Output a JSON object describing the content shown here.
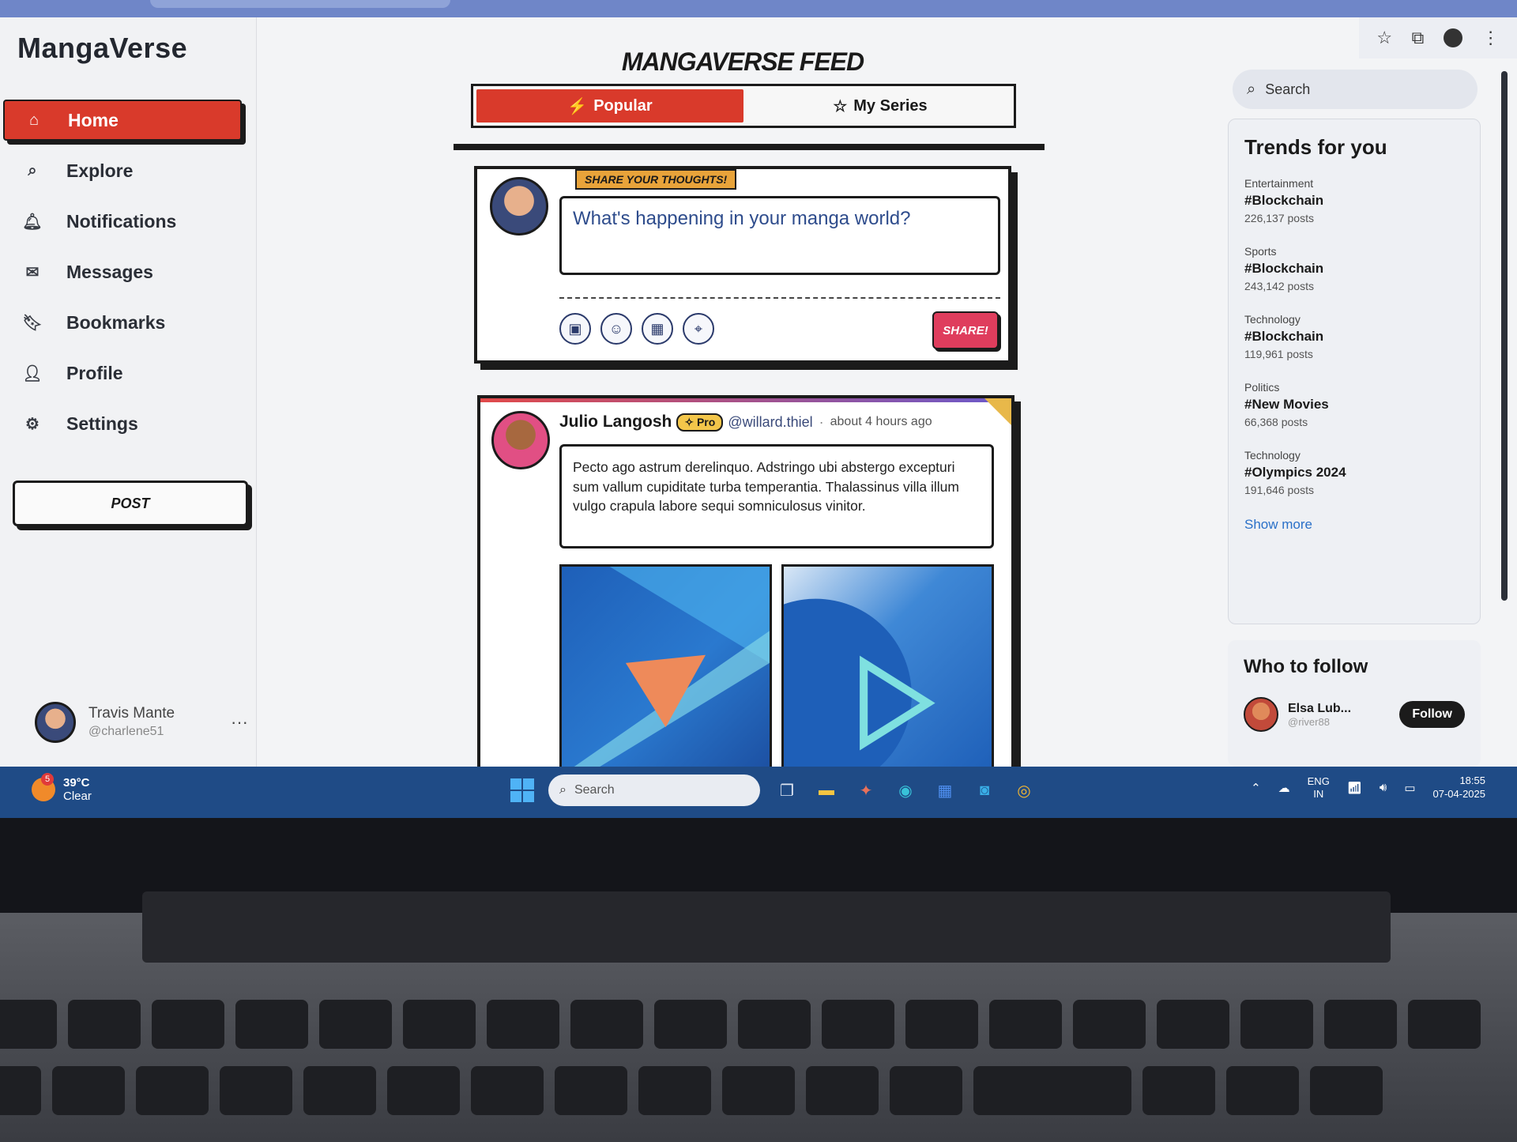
{
  "app": {
    "name": "MangaVerse"
  },
  "sidebar": {
    "items": [
      {
        "label": "Home",
        "icon": "home-icon",
        "glyph": "⌂"
      },
      {
        "label": "Explore",
        "icon": "search-icon",
        "glyph": "⌕"
      },
      {
        "label": "Notifications",
        "icon": "bell-icon",
        "glyph": "🔔︎"
      },
      {
        "label": "Messages",
        "icon": "mail-icon",
        "glyph": "✉"
      },
      {
        "label": "Bookmarks",
        "icon": "bookmark-icon",
        "glyph": "🔖︎"
      },
      {
        "label": "Profile",
        "icon": "user-icon",
        "glyph": "👤︎"
      },
      {
        "label": "Settings",
        "icon": "gear-icon",
        "glyph": "⚙"
      }
    ],
    "post_label": "POST",
    "user": {
      "name": "Travis Mante",
      "handle": "@charlene51",
      "more": "···"
    }
  },
  "feed": {
    "title": "MANGAVERSE FEED",
    "tabs": [
      {
        "label": "Popular",
        "glyph": "⚡"
      },
      {
        "label": "My Series",
        "glyph": "☆"
      }
    ],
    "composer": {
      "tag": "SHARE YOUR THOUGHTS!",
      "placeholder": "What's happening in your manga world?",
      "share_label": "SHARE!",
      "tools": [
        "image-icon",
        "emoji-icon",
        "calendar-icon",
        "location-icon"
      ]
    },
    "post": {
      "name": "Julio Langosh",
      "badge": "Pro",
      "handle": "@willard.thiel",
      "separator": "·",
      "time": "about 4 hours ago",
      "text": "Pecto ago astrum derelinquo. Adstringo ubi abstergo excepturi sum vallum cupiditate turba temperantia. Thalassinus villa illum vulgo crapula labore sequi somniculosus vinitor."
    }
  },
  "right": {
    "search_placeholder": "Search",
    "trends_title": "Trends for you",
    "trends": [
      {
        "category": "Entertainment",
        "tag": "#Blockchain",
        "count": "226,137 posts"
      },
      {
        "category": "Sports",
        "tag": "#Blockchain",
        "count": "243,142 posts"
      },
      {
        "category": "Technology",
        "tag": "#Blockchain",
        "count": "119,961 posts"
      },
      {
        "category": "Politics",
        "tag": "#New Movies",
        "count": "66,368 posts"
      },
      {
        "category": "Technology",
        "tag": "#Olympics 2024",
        "count": "191,646 posts"
      }
    ],
    "show_more": "Show more",
    "who_to_follow": "Who to follow",
    "follow_user": {
      "name": "Elsa Lub...",
      "handle": "@river88",
      "button": "Follow"
    }
  },
  "taskbar": {
    "weather_temp": "39°C",
    "weather_desc": "Clear",
    "weather_badge": "5",
    "search_placeholder": "Search",
    "lang_top": "ENG",
    "lang_bottom": "IN",
    "time": "18:55",
    "date": "07-04-2025"
  },
  "colors": {
    "accent": "#d93a2b",
    "share": "#df3d5d",
    "pro": "#f3c64a",
    "taskbar": "#1f4b86"
  }
}
